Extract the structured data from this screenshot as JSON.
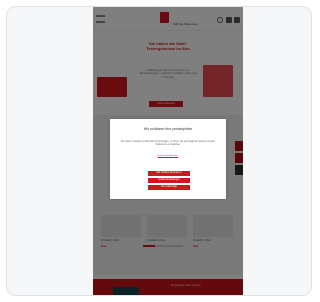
{
  "header": {
    "brand": "Stiftung Warentest",
    "icons": [
      "menu-icon",
      "search-icon",
      "user-icon",
      "cart-icon"
    ]
  },
  "hero": {
    "title": "Sie haben die Wahl: Testergebnisse im Abo",
    "text": "Unabhängige Tests zu Produkten und Dienstleistungen – jederzeit verfügbar, online und in der App.",
    "button": "Jetzt entdecken"
  },
  "products": [
    {
      "title": "Produkt im Test",
      "price": "Gut"
    },
    {
      "title": "Produkt im Test",
      "price": "Gut"
    },
    {
      "title": "Produkt im Test",
      "price": "Gut"
    }
  ],
  "footer": {
    "text": "Newsletter abonnieren"
  },
  "modal": {
    "title": "Wir schätzen ihre privatsphäre",
    "text": "Wir nutzen Cookies und ähnliche Technologien, um Ihnen die bestmögliche Nutzung unserer Website zu ermöglichen.",
    "link": "Datenschutzhinweise",
    "buttons": [
      "Alle Cookies akzeptieren",
      "Cookie-Einstellungen",
      "Nur notwendige"
    ]
  },
  "colors": {
    "accent": "#d2161e",
    "footer": "#c8141b",
    "chip": "#16454f"
  }
}
